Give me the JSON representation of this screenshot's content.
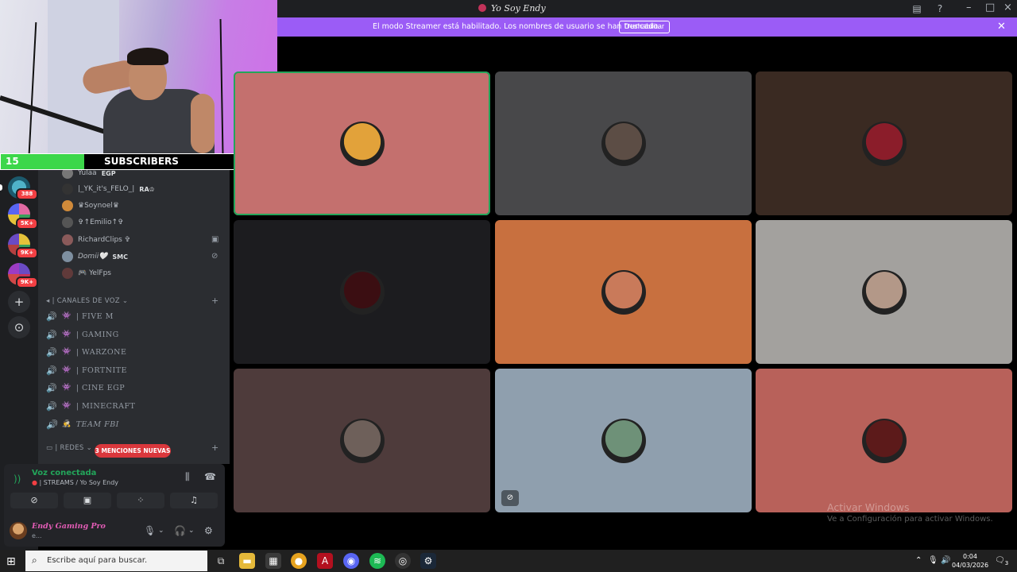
{
  "window": {
    "title": "Yo Soy Endy"
  },
  "banner": {
    "text": "El modo Streamer está habilitado. Los nombres de usuario se han truncado.",
    "button_label": "Deshabilitar"
  },
  "subscribers": {
    "current": "15",
    "label": "SUBSCRIBERS",
    "goal": "50",
    "progress": 0.3,
    "fill_color": "#3cd74a"
  },
  "servers": {
    "badges": [
      "388",
      "5K+",
      "9K+",
      "9K+"
    ],
    "add_icon": "+",
    "discover_icon": "⊙"
  },
  "members": [
    {
      "name": "Yulaa",
      "tag": "EGP"
    },
    {
      "name": "|_YK_it's_FELO_|",
      "tag": "RA♔"
    },
    {
      "name": "♛Soynoel♛",
      "tag": ""
    },
    {
      "name": "✞↑Emilio↑✞",
      "tag": ""
    },
    {
      "name": "RichardClips ✞",
      "tag": ""
    },
    {
      "name": "Domii🤍",
      "tag": "SMC"
    },
    {
      "name": "🎮 YelFps",
      "tag": ""
    }
  ],
  "voice_category": {
    "label": "| CANALES DE VOZ"
  },
  "voice_channels": [
    {
      "name": "| FIVE M"
    },
    {
      "name": "|  GAMING"
    },
    {
      "name": "| WARZONE"
    },
    {
      "name": "| FORTNITE"
    },
    {
      "name": "| CINE EGP"
    },
    {
      "name": "| MINECRAFT"
    },
    {
      "name": "TEAM FBI"
    }
  ],
  "redes_category": {
    "label": "| REDES"
  },
  "mentions_pill": "3 MENCIONES NUEVAS",
  "voice_panel": {
    "status": "Voz conectada",
    "channel": "| STREAMS / Yo Soy Endy"
  },
  "user_panel": {
    "name": "Endy Gaming Pro",
    "status": "e..."
  },
  "tiles": [
    {
      "bg": "#c4706e",
      "avatar": "#e2a23a"
    },
    {
      "bg": "#48484a",
      "avatar": "#5c4d45"
    },
    {
      "bg": "#3a2a22",
      "avatar": "#8b1d2a"
    },
    {
      "bg": "#1c1c1f",
      "avatar": "#3b0e12"
    },
    {
      "bg": "#c8703f",
      "avatar": "#c97a5a"
    },
    {
      "bg": "#a3a19e",
      "avatar": "#b39888"
    },
    {
      "bg": "#4e3b3b",
      "avatar": "#6e605a"
    },
    {
      "bg": "#8f9fae",
      "avatar": "#6e9178"
    },
    {
      "bg": "#b8615a",
      "avatar": "#5c1a1a"
    }
  ],
  "watermark": {
    "title": "Activar Windows",
    "subtitle": "Ve a Configuración para activar Windows."
  },
  "taskbar": {
    "search_placeholder": "Escribe aquí para buscar.",
    "time": "0:04",
    "date": "04/03/2026",
    "notification_count": "3"
  }
}
